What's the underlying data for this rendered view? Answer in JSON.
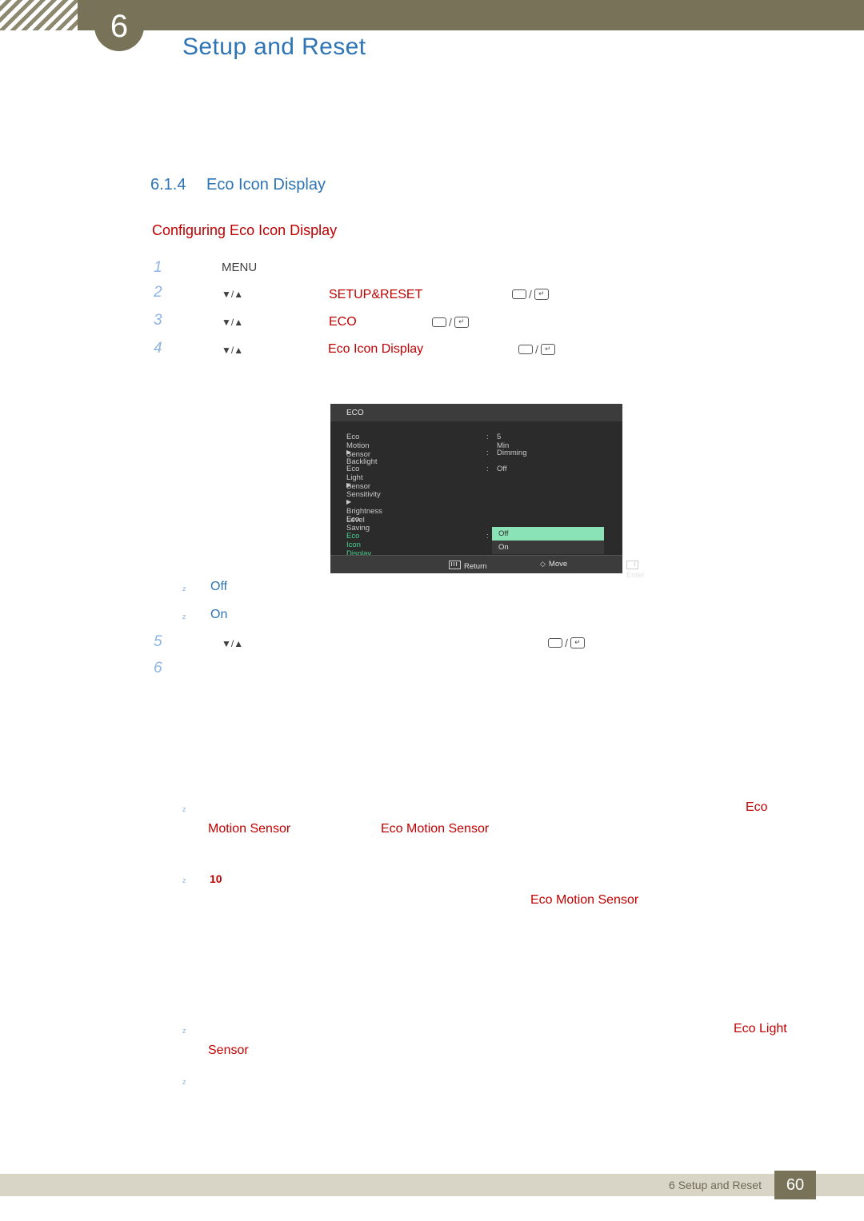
{
  "header": {
    "chapter_number": "6",
    "title": "Setup and Reset"
  },
  "section": {
    "number": "6.1.4",
    "title": "Eco Icon Display",
    "subtitle": "Configuring Eco Icon Display"
  },
  "steps": [
    {
      "num": "1",
      "label": "MENU",
      "label_color": "gray"
    },
    {
      "num": "2",
      "arrows": "▼/▲",
      "label": "SETUP&RESET",
      "label_color": "red"
    },
    {
      "num": "3",
      "arrows": "▼/▲",
      "label": "ECO",
      "label_color": "red"
    },
    {
      "num": "4",
      "arrows": "▼/▲",
      "label": "Eco Icon Display",
      "label_color": "red"
    },
    {
      "num": "5",
      "arrows": "▼/▲",
      "label": ""
    },
    {
      "num": "6",
      "arrows": "",
      "label": ""
    }
  ],
  "osd": {
    "title": "ECO",
    "rows": [
      {
        "label": "Eco Motion Sensor",
        "value": "5 Min",
        "sub": false
      },
      {
        "label": "Backlight",
        "value": "Dimming",
        "sub": true
      },
      {
        "label": "Eco Light Sensor",
        "value": "Off",
        "sub": false
      },
      {
        "label": "Sensitivity",
        "value": "",
        "sub": true
      },
      {
        "label": "Brightness Level",
        "value": "",
        "sub": true
      },
      {
        "label": "Eco Saving",
        "value": "",
        "sub": false
      },
      {
        "label": "Eco Icon Display",
        "value": "",
        "sub": false,
        "highlight": true
      }
    ],
    "dropdown": {
      "selected": "Off",
      "other": "On"
    },
    "footer": {
      "return": "Return",
      "move": "Move",
      "enter": "Enter"
    }
  },
  "options": [
    {
      "label": "Off"
    },
    {
      "label": "On"
    }
  ],
  "notes": [
    {
      "label": "Eco"
    },
    {
      "label": "Motion Sensor"
    },
    {
      "label": "Eco Motion Sensor"
    },
    {
      "label": "10"
    },
    {
      "label": "Eco Motion Sensor"
    },
    {
      "label": "Eco Light"
    },
    {
      "label": "Sensor"
    }
  ],
  "footer": {
    "text": "6 Setup and Reset",
    "page": "60"
  }
}
